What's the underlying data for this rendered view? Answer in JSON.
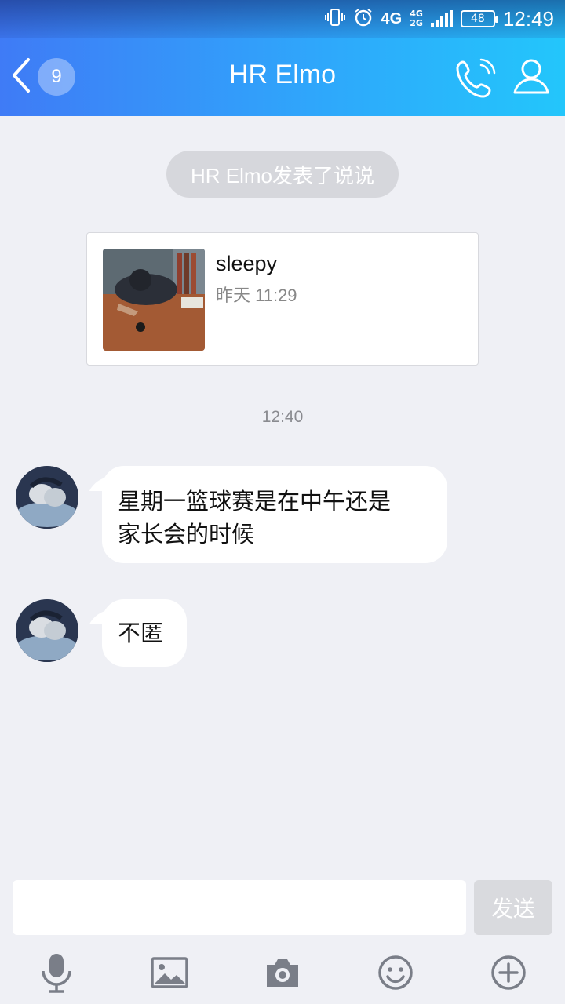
{
  "status_bar": {
    "network": "4G",
    "network_secondary_top": "4G",
    "network_secondary_bottom": "2G",
    "battery": "48",
    "time": "12:49"
  },
  "nav": {
    "back_count": "9",
    "title": "HR Elmo"
  },
  "content": {
    "notice": "HR Elmo发表了说说",
    "post": {
      "title": "sleepy",
      "time": "昨天 11:29"
    },
    "timestamp": "12:40",
    "messages": [
      {
        "text_line1": "星期一篮球赛是在中午还是",
        "text_line2": "家长会的时候"
      },
      {
        "text_line1": "不匿"
      }
    ]
  },
  "input": {
    "value": "",
    "send_label": "发送"
  },
  "colors": {
    "nav_gradient_start": "#3f7bf6",
    "nav_gradient_end": "#23c6fb",
    "background": "#eff0f5",
    "icon_gray": "#7a7e88"
  },
  "toolbar_icons": [
    "microphone-icon",
    "image-icon",
    "camera-icon",
    "emoji-icon",
    "plus-icon"
  ]
}
